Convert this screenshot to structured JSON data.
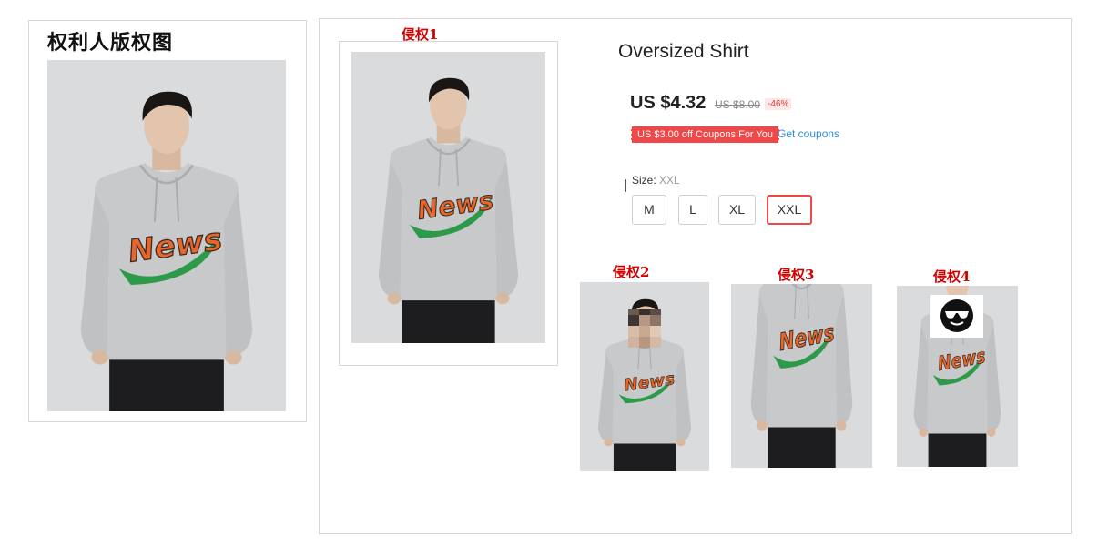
{
  "rights_holder": {
    "title": "权利人版权图"
  },
  "infringement_labels": [
    "侵权1",
    "侵权2",
    "侵权3",
    "侵权4"
  ],
  "product": {
    "title": "Oversized Shirt",
    "price": "US $4.32",
    "original_price": "US $8.00",
    "discount": "-46%",
    "coupon_tag": "US $3.00 off Coupons For You",
    "coupon_link": "Get coupons",
    "size_label": "Size:",
    "size_value": "XXL",
    "sizes": [
      "M",
      "L",
      "XL",
      "XXL"
    ],
    "selected_size": "XXL"
  },
  "photo_print_text": "News",
  "colors": {
    "accent_red": "#f04848",
    "label_red": "#d40000",
    "link_blue": "#2f8fd6",
    "hoodie_gray": "#c7c9ca",
    "print_orange": "#e8662a",
    "print_green": "#2d9a4a"
  },
  "icons": {
    "emoji_overlay": "sunglasses-face-icon",
    "face_blur": "pixelated-face-mosaic"
  }
}
